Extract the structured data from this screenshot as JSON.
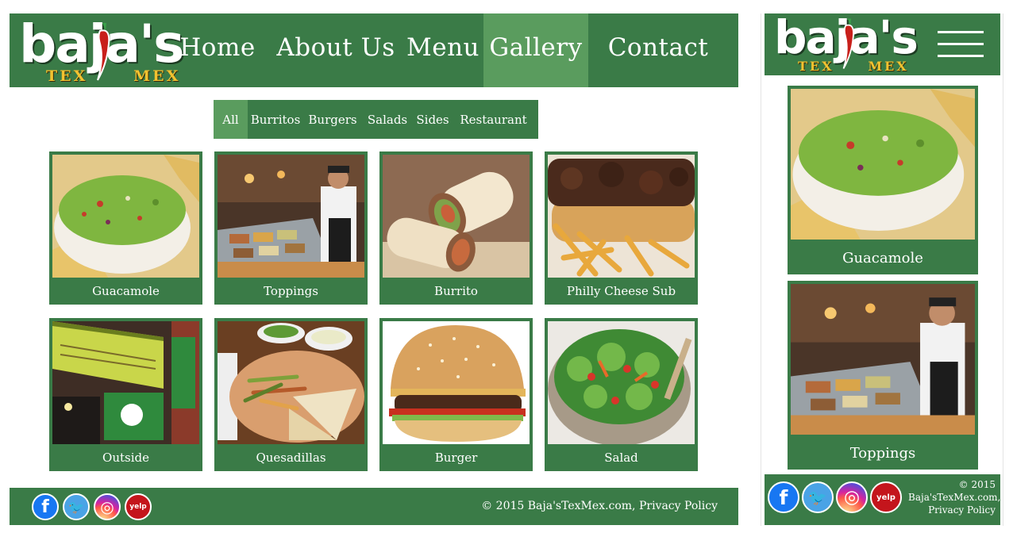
{
  "brand": {
    "name": "baja's",
    "tagline_left": "TEX",
    "tagline_right": "MEX",
    "colors": {
      "primary": "#3a7b47",
      "active": "#5a9c5e",
      "tagline": "#f2c230",
      "pepper": "#c8201b"
    }
  },
  "nav": {
    "items": [
      {
        "label": "Home"
      },
      {
        "label": "About Us"
      },
      {
        "label": "Menu"
      },
      {
        "label": "Gallery",
        "active": true
      },
      {
        "label": "Contact Us"
      }
    ]
  },
  "filters": {
    "items": [
      {
        "label": "All",
        "active": true
      },
      {
        "label": "Burritos"
      },
      {
        "label": "Burgers"
      },
      {
        "label": "Salads"
      },
      {
        "label": "Sides"
      },
      {
        "label": "Restaurant"
      }
    ]
  },
  "gallery": {
    "items": [
      {
        "caption": "Guacamole",
        "image": "guacamole-photo"
      },
      {
        "caption": "Toppings",
        "image": "toppings-bar-photo"
      },
      {
        "caption": "Burrito",
        "image": "burrito-photo"
      },
      {
        "caption": "Philly Cheese Sub",
        "image": "philly-sub-photo"
      },
      {
        "caption": "Outside",
        "image": "storefront-photo"
      },
      {
        "caption": "Quesadillas",
        "image": "quesadilla-photo"
      },
      {
        "caption": "Burger",
        "image": "burger-photo"
      },
      {
        "caption": "Salad",
        "image": "salad-photo"
      }
    ]
  },
  "footer": {
    "social": [
      {
        "icon": "facebook-icon",
        "glyph": "f"
      },
      {
        "icon": "twitter-icon",
        "glyph": "🐦"
      },
      {
        "icon": "instagram-icon",
        "glyph": "◎"
      },
      {
        "icon": "yelp-icon",
        "glyph": "yelp"
      }
    ],
    "copyright": "© 2015 Baja'sTexMex.com, Privacy Policy"
  },
  "mobile": {
    "menu_icon": "hamburger-menu-icon",
    "cards": [
      {
        "caption": "Guacamole"
      },
      {
        "caption": "Toppings"
      }
    ],
    "copyright_lines": [
      "© 2015",
      "Baja'sTexMex.com,",
      "Privacy Policy"
    ]
  }
}
